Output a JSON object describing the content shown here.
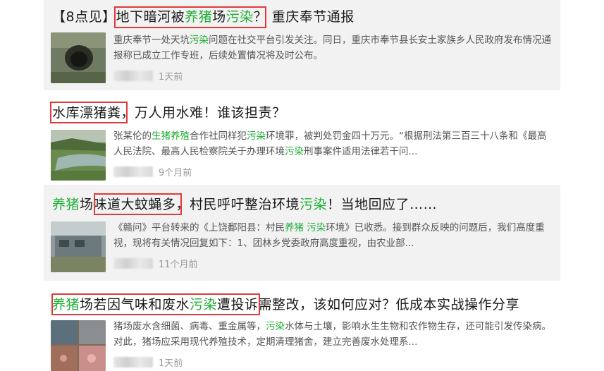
{
  "articles": [
    {
      "title_parts": [
        {
          "t": "【8点见】",
          "green": false
        },
        {
          "t": "地下暗河被",
          "green": false
        },
        {
          "t": "养猪",
          "green": true
        },
        {
          "t": "场",
          "green": false
        },
        {
          "t": "污染",
          "green": true
        },
        {
          "t": "？ 重庆奉节通报",
          "green": false
        }
      ],
      "desc": "重庆奉节一处天坑污染问题在社交平台引发关注。同日，重庆市奉节县长安土家族乡人民政府发布情况通报称已成立工作专班，后续处置情况将及时公布。",
      "time": "1天前"
    },
    {
      "title_parts": [
        {
          "t": "水库漂猪粪",
          "green": false
        },
        {
          "t": "，万人用水难！谁该担责？",
          "green": false
        }
      ],
      "desc": "张某伦的生猪养殖合作社同样犯污染环境罪，被判处罚金四十万元。“根据刑法第三百三十八条和《最高人民法院、最高人民检察院关于办理环境污染刑事案件适用法律若干问...",
      "time": "9个月前"
    },
    {
      "title_parts": [
        {
          "t": "养猪",
          "green": true
        },
        {
          "t": "场",
          "green": false
        },
        {
          "t": "味道大蚊蝇多",
          "green": false
        },
        {
          "t": "，村民呼吁整治环境",
          "green": false
        },
        {
          "t": "污染",
          "green": true
        },
        {
          "t": "！当地回应了……",
          "green": false
        }
      ],
      "desc": "《赣问》平台转来的《上饶鄱阳县：村民养猪 污染环境》已收悉。接到群众反映的问题后，我们高度重视，现将有关情况回复如下：1、团林乡党委政府高度重视，由农业部...",
      "time": "11个月前"
    },
    {
      "title_parts": [
        {
          "t": "养猪",
          "green": true
        },
        {
          "t": "场若因气味和废水",
          "green": false
        },
        {
          "t": "污染",
          "green": true
        },
        {
          "t": "遭投诉需整改，该如何应对？低成本实战操作分享",
          "green": false
        }
      ],
      "desc": "猪场废水含细菌、病毒、重金属等，污染水体与土壤，影响水生生物和农作物生存，还可能引发传染病。对此，猪场应采用现代养殖技术，定期清理猪舍，建立完善废水处理系...",
      "time": "1天前"
    }
  ],
  "colors": {
    "highlight_green": "#1fae34",
    "annotation_red": "#e03a3a",
    "card_gray": "#f2f2f2"
  },
  "icons": [
    "photo-thumbnail-cave",
    "photo-thumbnail-reservoir",
    "photo-thumbnail-building",
    "photo-thumbnail-pigfarm"
  ]
}
